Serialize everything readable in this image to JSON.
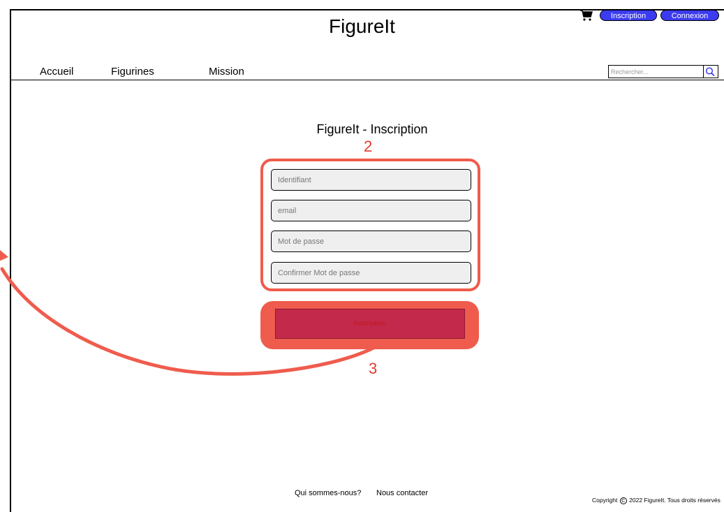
{
  "header": {
    "site_title": "FigureIt",
    "inscription_label": "Inscription",
    "connexion_label": "Connexion"
  },
  "nav": {
    "items": [
      {
        "label": "Accueil"
      },
      {
        "label": "Figurines"
      },
      {
        "label": "Mission"
      }
    ]
  },
  "search": {
    "placeholder": "Rechercher..."
  },
  "form": {
    "title": "FigureIt - Inscription",
    "fields": [
      {
        "placeholder": "Identifiant"
      },
      {
        "placeholder": "email"
      },
      {
        "placeholder": "Mot de passe"
      },
      {
        "placeholder": "Confirmer Mot de passe"
      }
    ],
    "submit_label": "Inscription"
  },
  "annotations": {
    "label_2": "2",
    "label_3": "3"
  },
  "footer": {
    "links": [
      {
        "label": "Qui sommes-nous?"
      },
      {
        "label": "Nous contacter"
      }
    ],
    "copyright_prefix": "Copyright",
    "copyright_symbol": "C",
    "copyright_suffix": "2022 FigureIt. Tous droits réservés"
  },
  "colors": {
    "header_button": "#3b3bf0",
    "annotation": "#ef5c4d",
    "submit_button": "#c3294a",
    "field_background": "#efefef"
  },
  "icons": {
    "cart": "cart-icon",
    "search": "search-icon"
  }
}
